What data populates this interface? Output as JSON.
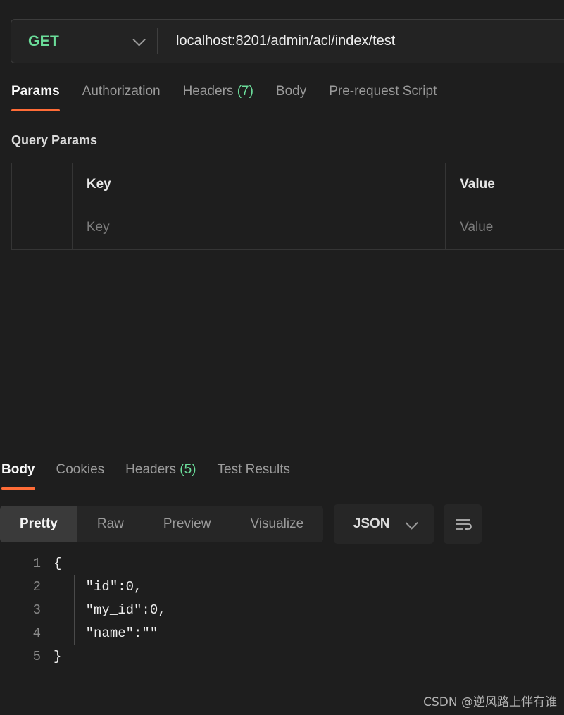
{
  "colors": {
    "background": "#1e1e1e",
    "accent_orange": "#ff6c37",
    "method_green": "#6bdd9a",
    "count_green": "#6bdd9a",
    "panel": "#262626",
    "border": "#353535"
  },
  "request": {
    "method": "GET",
    "method_dropdown_icon": "chevron-down-icon",
    "url": "localhost:8201/admin/acl/index/test",
    "url_placeholder": "Enter request URL",
    "tabs": [
      {
        "label": "Params",
        "active": true,
        "count": ""
      },
      {
        "label": "Authorization",
        "active": false,
        "count": ""
      },
      {
        "label": "Headers",
        "active": false,
        "count": "(7)"
      },
      {
        "label": "Body",
        "active": false,
        "count": ""
      },
      {
        "label": "Pre-request Script",
        "active": false,
        "count": ""
      }
    ],
    "query_params": {
      "title": "Query Params",
      "columns": [
        "Key",
        "Value"
      ],
      "rows": [
        {
          "key": "",
          "value": "",
          "key_placeholder": "Key",
          "value_placeholder": "Value",
          "checked": false
        }
      ]
    }
  },
  "response": {
    "tabs": [
      {
        "label": "Body",
        "active": true,
        "count": ""
      },
      {
        "label": "Cookies",
        "active": false,
        "count": ""
      },
      {
        "label": "Headers",
        "active": false,
        "count": "(5)"
      },
      {
        "label": "Test Results",
        "active": false,
        "count": ""
      }
    ],
    "format_tabs": [
      {
        "label": "Pretty",
        "active": true
      },
      {
        "label": "Raw",
        "active": false
      },
      {
        "label": "Preview",
        "active": false
      },
      {
        "label": "Visualize",
        "active": false
      }
    ],
    "language": "JSON",
    "language_dropdown_icon": "chevron-down-icon",
    "wrap_button_icon": "word-wrap-icon",
    "body_lines": [
      {
        "number": "1",
        "text": "{"
      },
      {
        "number": "2",
        "text": "    \"id\":0,"
      },
      {
        "number": "3",
        "text": "    \"my_id\":0,"
      },
      {
        "number": "4",
        "text": "    \"name\":\"\""
      },
      {
        "number": "5",
        "text": "}"
      }
    ]
  },
  "watermark": "CSDN @逆风路上伴有谁"
}
